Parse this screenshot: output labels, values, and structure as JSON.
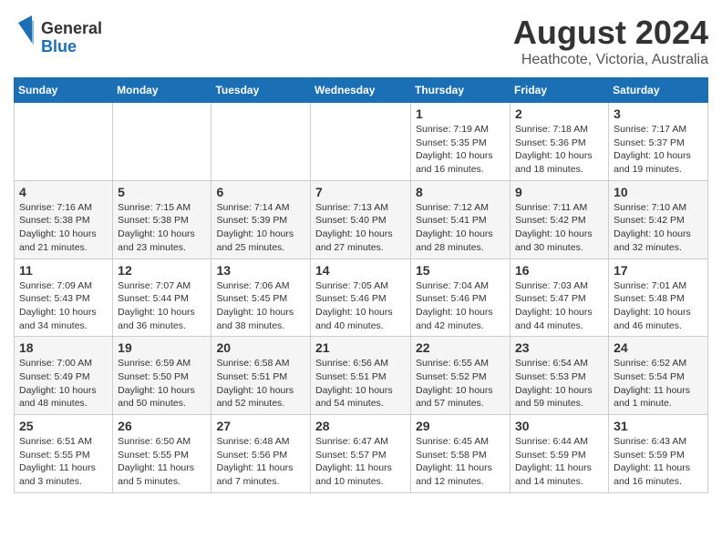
{
  "header": {
    "logo_general": "General",
    "logo_blue": "Blue",
    "month_year": "August 2024",
    "location": "Heathcote, Victoria, Australia"
  },
  "calendar": {
    "days_of_week": [
      "Sunday",
      "Monday",
      "Tuesday",
      "Wednesday",
      "Thursday",
      "Friday",
      "Saturday"
    ],
    "weeks": [
      {
        "days": [
          {
            "num": "",
            "info": ""
          },
          {
            "num": "",
            "info": ""
          },
          {
            "num": "",
            "info": ""
          },
          {
            "num": "",
            "info": ""
          },
          {
            "num": "1",
            "info": "Sunrise: 7:19 AM\nSunset: 5:35 PM\nDaylight: 10 hours\nand 16 minutes."
          },
          {
            "num": "2",
            "info": "Sunrise: 7:18 AM\nSunset: 5:36 PM\nDaylight: 10 hours\nand 18 minutes."
          },
          {
            "num": "3",
            "info": "Sunrise: 7:17 AM\nSunset: 5:37 PM\nDaylight: 10 hours\nand 19 minutes."
          }
        ]
      },
      {
        "days": [
          {
            "num": "4",
            "info": "Sunrise: 7:16 AM\nSunset: 5:38 PM\nDaylight: 10 hours\nand 21 minutes."
          },
          {
            "num": "5",
            "info": "Sunrise: 7:15 AM\nSunset: 5:38 PM\nDaylight: 10 hours\nand 23 minutes."
          },
          {
            "num": "6",
            "info": "Sunrise: 7:14 AM\nSunset: 5:39 PM\nDaylight: 10 hours\nand 25 minutes."
          },
          {
            "num": "7",
            "info": "Sunrise: 7:13 AM\nSunset: 5:40 PM\nDaylight: 10 hours\nand 27 minutes."
          },
          {
            "num": "8",
            "info": "Sunrise: 7:12 AM\nSunset: 5:41 PM\nDaylight: 10 hours\nand 28 minutes."
          },
          {
            "num": "9",
            "info": "Sunrise: 7:11 AM\nSunset: 5:42 PM\nDaylight: 10 hours\nand 30 minutes."
          },
          {
            "num": "10",
            "info": "Sunrise: 7:10 AM\nSunset: 5:42 PM\nDaylight: 10 hours\nand 32 minutes."
          }
        ]
      },
      {
        "days": [
          {
            "num": "11",
            "info": "Sunrise: 7:09 AM\nSunset: 5:43 PM\nDaylight: 10 hours\nand 34 minutes."
          },
          {
            "num": "12",
            "info": "Sunrise: 7:07 AM\nSunset: 5:44 PM\nDaylight: 10 hours\nand 36 minutes."
          },
          {
            "num": "13",
            "info": "Sunrise: 7:06 AM\nSunset: 5:45 PM\nDaylight: 10 hours\nand 38 minutes."
          },
          {
            "num": "14",
            "info": "Sunrise: 7:05 AM\nSunset: 5:46 PM\nDaylight: 10 hours\nand 40 minutes."
          },
          {
            "num": "15",
            "info": "Sunrise: 7:04 AM\nSunset: 5:46 PM\nDaylight: 10 hours\nand 42 minutes."
          },
          {
            "num": "16",
            "info": "Sunrise: 7:03 AM\nSunset: 5:47 PM\nDaylight: 10 hours\nand 44 minutes."
          },
          {
            "num": "17",
            "info": "Sunrise: 7:01 AM\nSunset: 5:48 PM\nDaylight: 10 hours\nand 46 minutes."
          }
        ]
      },
      {
        "days": [
          {
            "num": "18",
            "info": "Sunrise: 7:00 AM\nSunset: 5:49 PM\nDaylight: 10 hours\nand 48 minutes."
          },
          {
            "num": "19",
            "info": "Sunrise: 6:59 AM\nSunset: 5:50 PM\nDaylight: 10 hours\nand 50 minutes."
          },
          {
            "num": "20",
            "info": "Sunrise: 6:58 AM\nSunset: 5:51 PM\nDaylight: 10 hours\nand 52 minutes."
          },
          {
            "num": "21",
            "info": "Sunrise: 6:56 AM\nSunset: 5:51 PM\nDaylight: 10 hours\nand 54 minutes."
          },
          {
            "num": "22",
            "info": "Sunrise: 6:55 AM\nSunset: 5:52 PM\nDaylight: 10 hours\nand 57 minutes."
          },
          {
            "num": "23",
            "info": "Sunrise: 6:54 AM\nSunset: 5:53 PM\nDaylight: 10 hours\nand 59 minutes."
          },
          {
            "num": "24",
            "info": "Sunrise: 6:52 AM\nSunset: 5:54 PM\nDaylight: 11 hours\nand 1 minute."
          }
        ]
      },
      {
        "days": [
          {
            "num": "25",
            "info": "Sunrise: 6:51 AM\nSunset: 5:55 PM\nDaylight: 11 hours\nand 3 minutes."
          },
          {
            "num": "26",
            "info": "Sunrise: 6:50 AM\nSunset: 5:55 PM\nDaylight: 11 hours\nand 5 minutes."
          },
          {
            "num": "27",
            "info": "Sunrise: 6:48 AM\nSunset: 5:56 PM\nDaylight: 11 hours\nand 7 minutes."
          },
          {
            "num": "28",
            "info": "Sunrise: 6:47 AM\nSunset: 5:57 PM\nDaylight: 11 hours\nand 10 minutes."
          },
          {
            "num": "29",
            "info": "Sunrise: 6:45 AM\nSunset: 5:58 PM\nDaylight: 11 hours\nand 12 minutes."
          },
          {
            "num": "30",
            "info": "Sunrise: 6:44 AM\nSunset: 5:59 PM\nDaylight: 11 hours\nand 14 minutes."
          },
          {
            "num": "31",
            "info": "Sunrise: 6:43 AM\nSunset: 5:59 PM\nDaylight: 11 hours\nand 16 minutes."
          }
        ]
      }
    ]
  }
}
